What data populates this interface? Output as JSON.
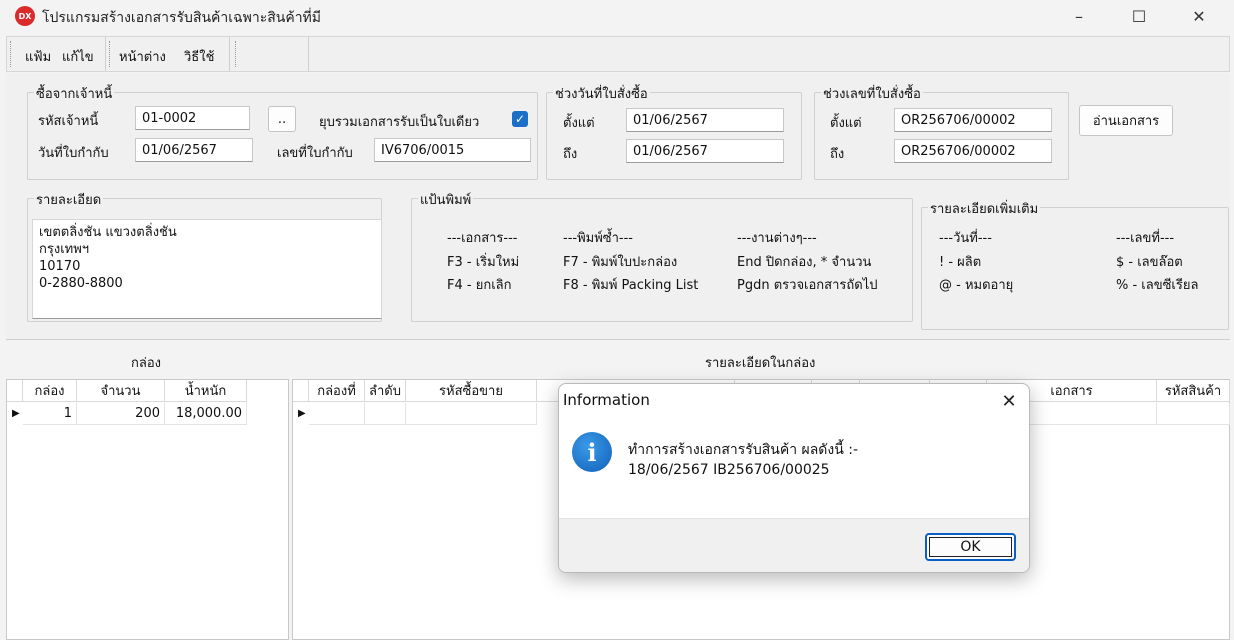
{
  "window": {
    "icon_text": "DX",
    "title": "โปรแกรมสร้างเอกสารรับสินค้าเฉพาะสินค้าที่มี",
    "controls": [
      "–",
      "☐",
      "✕"
    ]
  },
  "menu": {
    "items": [
      "แฟ้ม",
      "แก้ไข",
      "หน้าต่าง",
      "วิธีใช้"
    ]
  },
  "vendor_group": {
    "title": "ซื้อจากเจ้าหนี้",
    "code_label": "รหัสเจ้าหนี้",
    "code_value": "01-0002",
    "lookup_button": "..",
    "merge_label": "ยุบรวมเอกสารรับเป็นใบเดียว",
    "merge_checked": true,
    "invoice_date_label": "วันที่ใบกำกับ",
    "invoice_date_value": "01/06/2567",
    "invoice_no_label": "เลขที่ใบกำกับ",
    "invoice_no_value": "IV6706/0015"
  },
  "po_date_group": {
    "title": "ช่วงวันที่ใบสั่งซื้อ",
    "from_label": "ตั้งแต่",
    "from_value": "01/06/2567",
    "to_label": "ถึง",
    "to_value": "01/06/2567"
  },
  "po_no_group": {
    "title": "ช่วงเลขที่ใบสั่งซื้อ",
    "from_label": "ตั้งแต่",
    "from_value": "OR256706/00002",
    "to_label": "ถึง",
    "to_value": "OR256706/00002"
  },
  "read_button": "อ่านเอกสาร",
  "detail_group": {
    "title": "รายละเอียด",
    "lines": [
      "เขตตลิ่งชัน แขวงตลิ่งชัน",
      "กรุงเทพฯ",
      "10170",
      "0-2880-8800"
    ]
  },
  "keyboard_group": {
    "title": "แป้นพิมพ์",
    "col1": [
      "---เอกสาร---",
      "F3 - เริ่มใหม่",
      "F4 - ยกเลิก"
    ],
    "col2": [
      "---พิมพ์ซ้ำ---",
      "F7 - พิมพ์ใบปะกล่อง",
      "F8 - พิมพ์ Packing List"
    ],
    "col3": [
      "---งานต่างๆ---",
      "End ปิดกล่อง, * จำนวน",
      "Pgdn ตรวจเอกสารถัดไป"
    ]
  },
  "extra_group": {
    "title": "รายละเอียดเพิ่มเติม",
    "col1": [
      "---วันที่---",
      "! - ผลิต",
      "@ - หมดอายุ"
    ],
    "col2": [
      "---เลขที่---",
      "$ - เลขล๊อต",
      "% - เลขซีเรียล"
    ]
  },
  "box_grid": {
    "title": "กล่อง",
    "headers": [
      "กล่อง",
      "จำนวน",
      "น้ำหนัก"
    ],
    "rows": [
      [
        "1",
        "200",
        "18,000.00"
      ]
    ]
  },
  "detail_grid": {
    "title": "รายละเอียดในกล่อง",
    "headers": [
      "กล่องที่",
      "ลำดับ",
      "รหัสซื้อขาย",
      "",
      "",
      "",
      "",
      "",
      "เอกสาร",
      "รหัสสินค้า"
    ]
  },
  "dialog": {
    "title": "Information",
    "message_line1": "ทำการสร้างเอกสารรับสินค้า ผลดังนี้ :-",
    "message_line2": "18/06/2567 IB256706/00025",
    "ok_label": "OK"
  }
}
